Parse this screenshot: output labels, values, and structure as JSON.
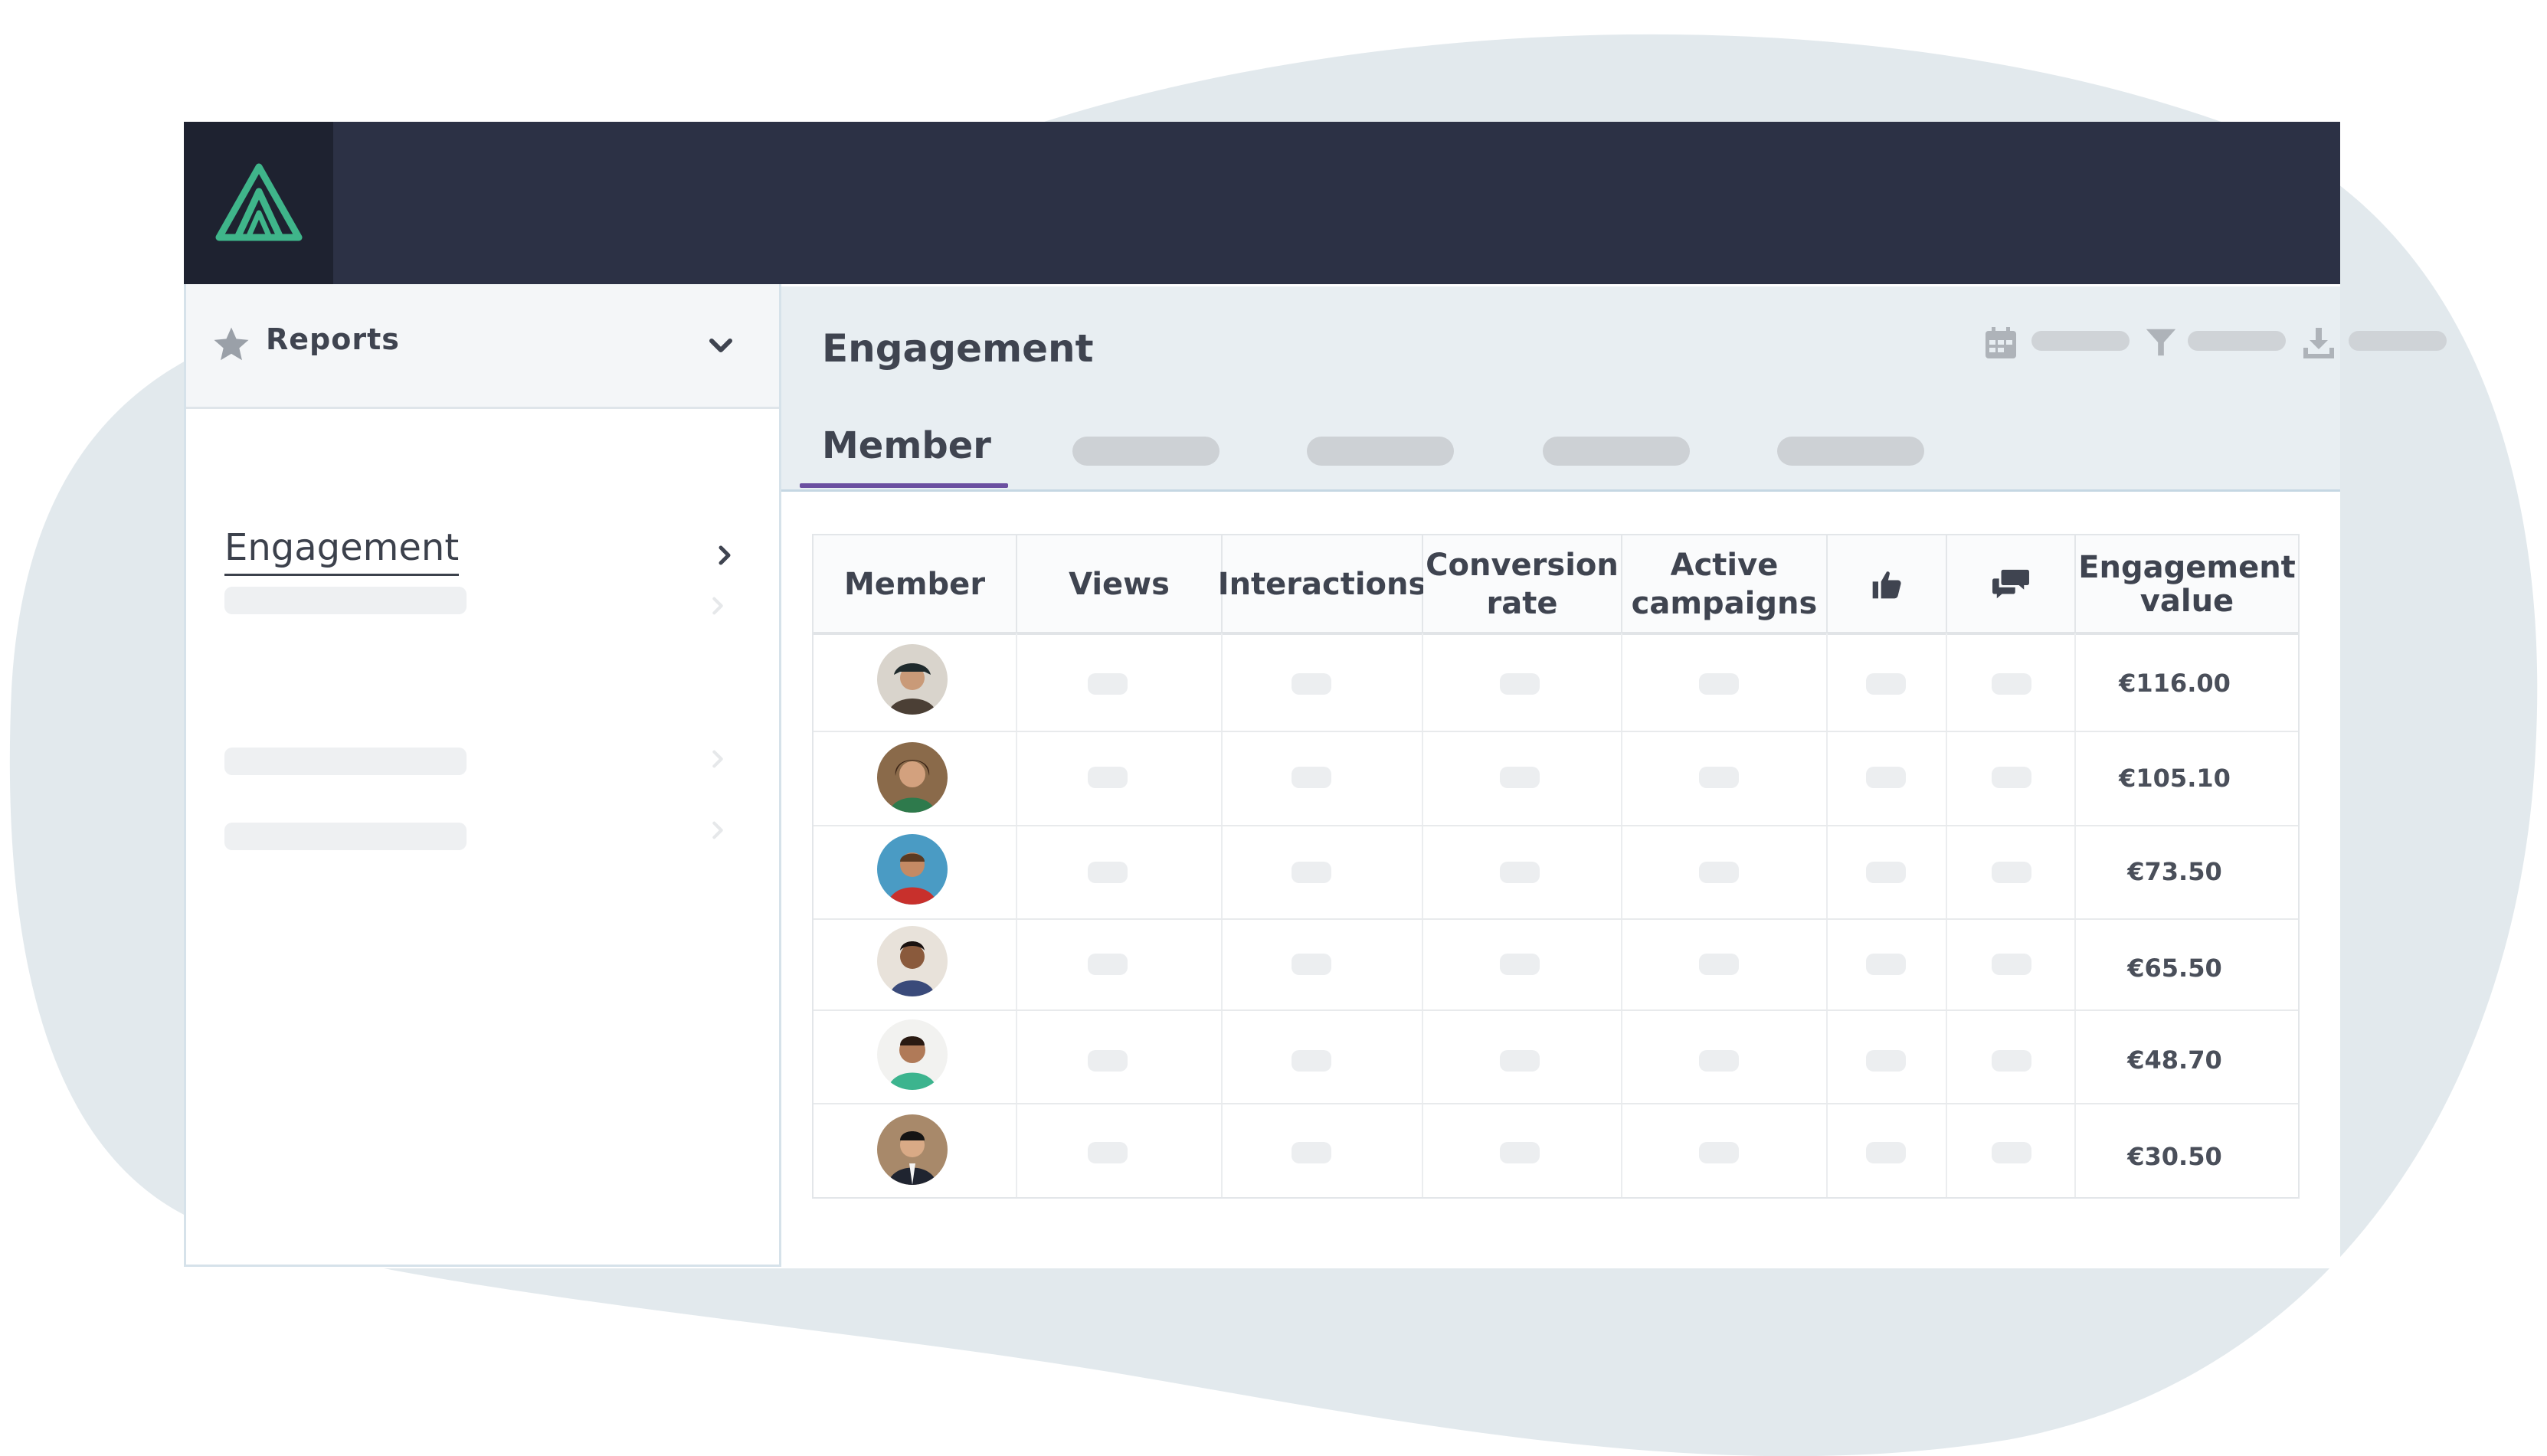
{
  "sidebar": {
    "header_label": "Reports",
    "active_item": "Engagement"
  },
  "main": {
    "title": "Engagement",
    "active_tab": "Member"
  },
  "table": {
    "columns": [
      "Member",
      "Views",
      "Interactions",
      "Conversion rate",
      "Active campaigns",
      "thumbs-up-icon",
      "comments-icon",
      "Engagement value"
    ],
    "header": {
      "member": "Member",
      "views": "Views",
      "interactions": "Interactions",
      "conversion_1": "Conversion",
      "conversion_2": "rate",
      "active_1": "Active",
      "active_2": "campaigns",
      "engagement_1": "Engagement",
      "engagement_2": "value"
    },
    "rows": [
      {
        "value": "€116.00"
      },
      {
        "value": "€105.10"
      },
      {
        "value": "€73.50"
      },
      {
        "value": "€65.50"
      },
      {
        "value": "€48.70"
      },
      {
        "value": "€30.50"
      }
    ]
  },
  "icons": {
    "logo": "brand-logo-icon",
    "star": "star-icon",
    "chevron_down": "chevron-down-icon",
    "chevron_right": "chevron-right-icon",
    "calendar": "calendar-icon",
    "filter": "filter-icon",
    "download": "download-icon",
    "thumbs_up": "thumbs-up-icon",
    "comments": "comments-icon"
  },
  "colors": {
    "topbar": "#2c3145",
    "logo_bg": "#1e2230",
    "logo": "#3fb58a",
    "tab_underline": "#6b4fa0",
    "blob": "#e2e9ed"
  }
}
